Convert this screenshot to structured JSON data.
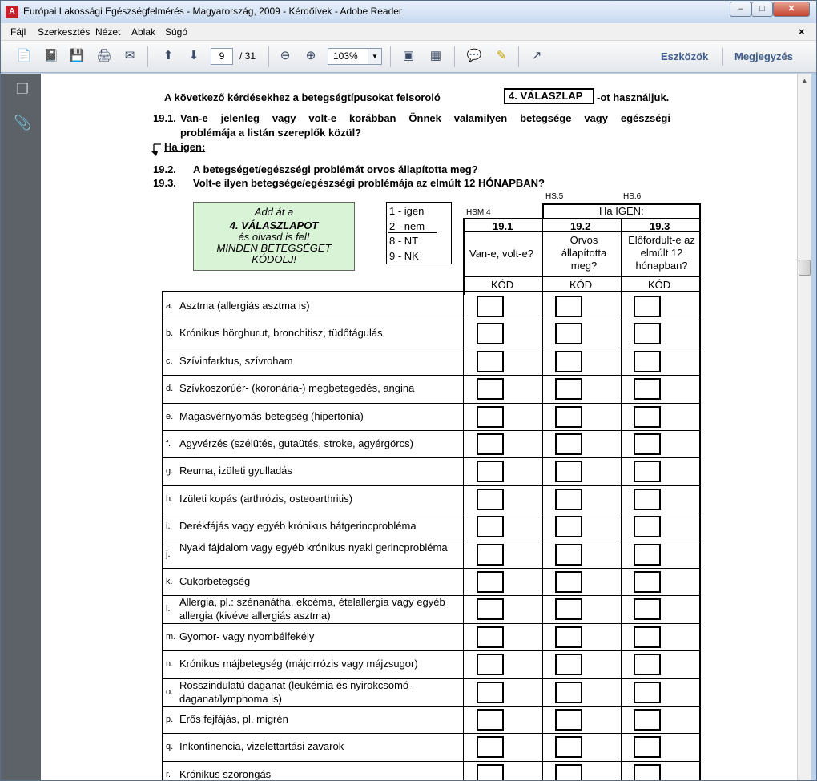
{
  "window": {
    "title": "Európai Lakossági Egészségfelmérés - Magyarország, 2009 - Kérdőívek - Adobe Reader",
    "buttons": {
      "minimize": "–",
      "maximize": "□",
      "close": "✕"
    }
  },
  "menu": [
    "Fájl",
    "Szerkesztés",
    "Nézet",
    "Ablak",
    "Súgó"
  ],
  "toolbar": {
    "page_current": "9",
    "page_total": "/ 31",
    "zoom": "103%",
    "tools": "Eszközök",
    "comments": "Megjegyzés"
  },
  "document": {
    "lead_text": "A következő kérdésekhez a betegségtípusokat felsoroló",
    "lead_box": "4. VÁLASZLAP",
    "lead_suffix": "-ot   használjuk.",
    "q191_num": "19.1.",
    "q191_line1": "Van-e jelenleg vagy volt-e korábban Önnek valamilyen betegsége vagy egészségi",
    "q191_line2": "problémája a listán szereplők közül?",
    "ha_igen": "Ha igen:",
    "q192_num": "19.2.",
    "q192_text": "A betegséget/egészségi problémát orvos állapította meg?",
    "q193_num": "19.3.",
    "q193_text": "Volt-e ilyen betegsége/egészségi problémája az elmúlt 12 HÓNAPBAN?",
    "green_box": {
      "line1": "Add át a",
      "line2": "4. VÁLASZLAPOT",
      "line3": "és olvasd is fel!",
      "line4": "MINDEN BETEGSÉGET",
      "line5": "KÓDOLJ!"
    },
    "codes": [
      "1  -  igen",
      "2  -  nem",
      "8  -  NT",
      "9  -  NK"
    ],
    "var_hsm4": "HSM.4",
    "var_hs5": "HS.5",
    "var_hs6": "HS.6",
    "ha_igen_header": "Ha IGEN:",
    "col_191": "19.1",
    "col_192": "19.2",
    "col_193": "19.3",
    "col_191_q": "Van-e, volt-e?",
    "col_192_q": "Orvos állapította meg?",
    "col_193_q": "Előfordult-e az elmúlt 12 hónapban?",
    "kod": "KÓD",
    "rows": [
      {
        "letter": "a.",
        "text": "Asztma (allergiás asztma is)"
      },
      {
        "letter": "b.",
        "text": "Krónikus hörghurut, bronchitisz, tüdőtágulás"
      },
      {
        "letter": "c.",
        "text": "Szívinfarktus, szívroham"
      },
      {
        "letter": "d.",
        "text": "Szívkoszorúér- (koronária-) megbetegedés, angina"
      },
      {
        "letter": "e.",
        "text": "Magasvérnyomás-betegség (hipertónia)"
      },
      {
        "letter": "f.",
        "text": "Agyvérzés (szélütés, gutaütés, stroke, agyérgörcs)"
      },
      {
        "letter": "g.",
        "text": "Reuma, izületi gyulladás"
      },
      {
        "letter": "h.",
        "text": "Izületi kopás (arthrózis, osteoarthritis)"
      },
      {
        "letter": "i.",
        "text": "Derékfájás vagy egyéb krónikus hátgerincprobléma"
      },
      {
        "letter": "j.",
        "text": "Nyaki fájdalom vagy egyéb krónikus nyaki gerincprobléma"
      },
      {
        "letter": "k.",
        "text": "Cukorbetegség"
      },
      {
        "letter": "l.",
        "text": "Allergia, pl.: szénanátha, ekcéma, ételallergia vagy egyéb allergia (kivéve allergiás asztma)"
      },
      {
        "letter": "m.",
        "text": "Gyomor- vagy nyombélfekély"
      },
      {
        "letter": "n.",
        "text": "Krónikus májbetegség (májcirrózis vagy májzsugor)"
      },
      {
        "letter": "o.",
        "text": "Rosszindulatú daganat (leukémia és nyirokcsomó-daganat/lymphoma is)"
      },
      {
        "letter": "p.",
        "text": "Erős fejfájás, pl. migrén"
      },
      {
        "letter": "q.",
        "text": "Inkontinencia, vizelettartási zavarok"
      },
      {
        "letter": "r.",
        "text": "Krónikus szorongás"
      }
    ]
  }
}
